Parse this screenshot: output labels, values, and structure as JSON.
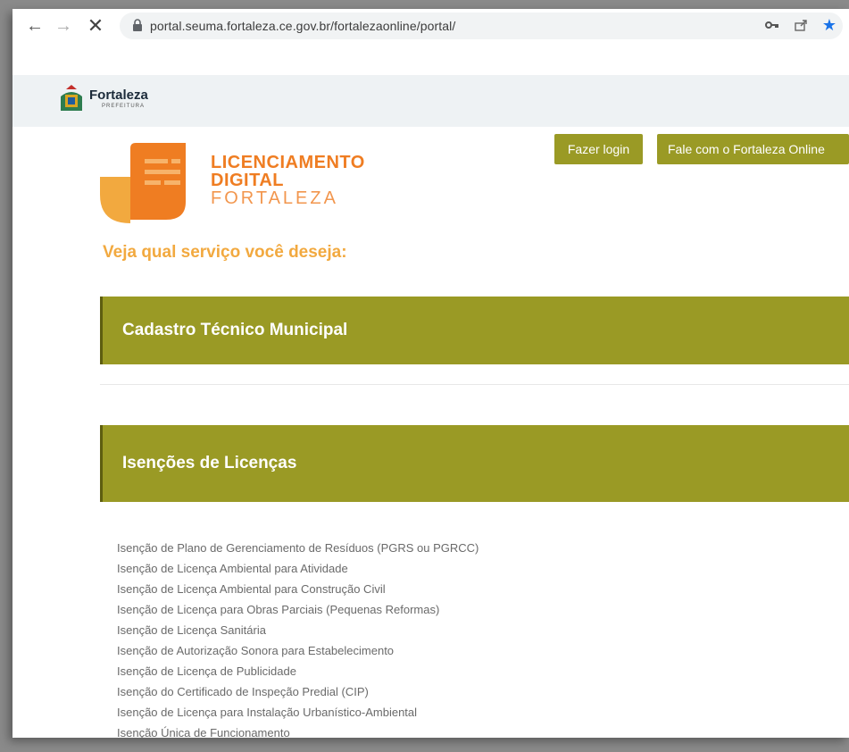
{
  "browser": {
    "url": "portal.seuma.fortaleza.ce.gov.br/fortalezaonline/portal/"
  },
  "header": {
    "city_name": "Fortaleza",
    "city_sub": "PREFEITURA"
  },
  "brand": {
    "line1": "LICENCIAMENTO",
    "line2": "DIGITAL",
    "line3": "FORTALEZA"
  },
  "actions": {
    "login_label": "Fazer login",
    "contact_label": "Fale com o Fortaleza Online"
  },
  "prompt": "Veja qual serviço você deseja:",
  "sections": [
    {
      "title": "Cadastro Técnico Municipal"
    },
    {
      "title": "Isenções de Licenças"
    }
  ],
  "services": [
    "Isenção de Plano de Gerenciamento de Resíduos (PGRS ou PGRCC)",
    "Isenção de Licença Ambiental para Atividade",
    "Isenção de Licença Ambiental para Construção Civil",
    "Isenção de Licença para Obras Parciais (Pequenas Reformas)",
    "Isenção de Licença Sanitária",
    "Isenção de Autorização Sonora para Estabelecimento",
    "Isenção de Licença de Publicidade",
    "Isenção do Certificado de Inspeção Predial (CIP)",
    "Isenção de Licença para Instalação Urbanístico-Ambiental",
    "Isenção Única de Funcionamento"
  ],
  "colors": {
    "accent_olive": "#9a9a25",
    "brand_orange": "#ef7d22",
    "prompt_orange": "#f2a93f"
  },
  "icons": [
    "back-arrow-icon",
    "forward-arrow-icon",
    "stop-icon",
    "lock-icon",
    "key-icon",
    "share-icon",
    "star-icon"
  ]
}
